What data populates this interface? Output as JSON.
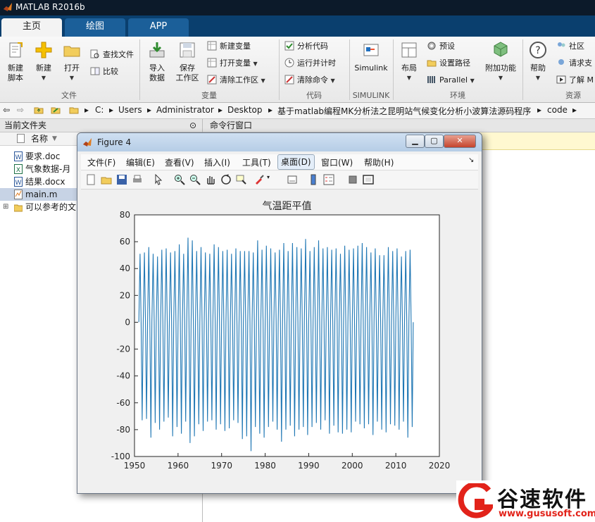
{
  "app": {
    "title": "MATLAB R2016b"
  },
  "tabs": [
    {
      "label": "主页",
      "active": true
    },
    {
      "label": "绘图",
      "active": false
    },
    {
      "label": "APP",
      "active": false
    }
  ],
  "toolstrip": {
    "file": {
      "label": "文件",
      "new_script": "新建\n脚本",
      "new": "新建",
      "open": "打开",
      "find_files": "查找文件",
      "compare": "比较"
    },
    "variable": {
      "label": "变量",
      "import": "导入\n数据",
      "save_ws": "保存\n工作区",
      "new_var": "新建变量",
      "open_var": "打开变量",
      "clear_ws": "清除工作区"
    },
    "code": {
      "label": "代码",
      "analyze": "分析代码",
      "run_time": "运行并计时",
      "clear_cmd": "清除命令"
    },
    "simulink": {
      "label": "SIMULINK",
      "button": "Simulink"
    },
    "env": {
      "label": "环境",
      "layout": "布局",
      "prefs": "预设",
      "set_path": "设置路径",
      "parallel": "Parallel",
      "addons": "附加功能"
    },
    "resources": {
      "label": "资源",
      "help": "帮助",
      "community": "社区",
      "support": "请求支",
      "learn": "了解 M"
    }
  },
  "address": {
    "crumbs": [
      "C:",
      "Users",
      "Administrator",
      "Desktop",
      "基于matlab编程MK分析法之昆明站气候变化分析小波算法源码程序",
      "code"
    ]
  },
  "current_folder": {
    "title": "当前文件夹",
    "column": "名称",
    "files": [
      {
        "name": "要求.doc",
        "type": "word",
        "selected": false
      },
      {
        "name": "气象数据-月",
        "type": "excel",
        "selected": false
      },
      {
        "name": "结果.docx",
        "type": "word",
        "selected": false
      },
      {
        "name": "main.m",
        "type": "m",
        "selected": true
      },
      {
        "name": "可以参考的文",
        "type": "folder",
        "selected": false
      }
    ]
  },
  "command_window": {
    "title": "命令行窗口"
  },
  "figure": {
    "title": "Figure 4",
    "menu": [
      "文件(F)",
      "编辑(E)",
      "查看(V)",
      "插入(I)",
      "工具(T)",
      "桌面(D)",
      "窗口(W)",
      "帮助(H)"
    ],
    "active_menu": "桌面(D)"
  },
  "chart_data": {
    "type": "line",
    "title": "气温距平值",
    "xlabel": "",
    "ylabel": "",
    "xlim": [
      1950,
      2020
    ],
    "ylim": [
      -100,
      80
    ],
    "xticks": [
      1950,
      1960,
      1970,
      1980,
      1990,
      2000,
      2010,
      2020
    ],
    "yticks": [
      -100,
      -80,
      -60,
      -40,
      -20,
      0,
      20,
      40,
      60,
      80
    ],
    "color": "#1f77b4",
    "series": [
      {
        "x_start": 1951,
        "x_step": 1,
        "peaks": [
          51,
          52,
          56,
          51,
          49,
          54,
          55,
          52,
          53,
          58,
          51,
          63,
          61,
          53,
          56,
          52,
          51,
          58,
          56,
          53,
          54,
          51,
          55,
          53,
          53,
          53,
          52,
          61,
          54,
          57,
          55,
          52,
          54,
          59,
          53,
          59,
          56,
          55,
          62,
          53,
          56,
          61,
          55,
          56,
          54,
          55,
          51,
          57,
          54,
          55,
          57,
          59,
          56,
          52,
          55,
          50,
          50,
          56,
          53,
          55,
          49,
          53,
          54
        ],
        "troughs": [
          -73,
          -72,
          -86,
          -75,
          -80,
          -74,
          -71,
          -85,
          -78,
          -83,
          -74,
          -90,
          -85,
          -76,
          -81,
          -74,
          -73,
          -80,
          -76,
          -81,
          -79,
          -73,
          -75,
          -87,
          -85,
          -96,
          -78,
          -83,
          -86,
          -78,
          -74,
          -80,
          -89,
          -80,
          -77,
          -85,
          -80,
          -78,
          -84,
          -78,
          -75,
          -80,
          -73,
          -83,
          -77,
          -82,
          -83,
          -80,
          -82,
          -74,
          -76,
          -79,
          -76,
          -84,
          -74,
          -80,
          -82,
          -76,
          -77,
          -80,
          -74,
          -86,
          -78
        ]
      }
    ]
  },
  "watermark": {
    "brand": "谷速软件",
    "url": "www.gususoft.com"
  }
}
